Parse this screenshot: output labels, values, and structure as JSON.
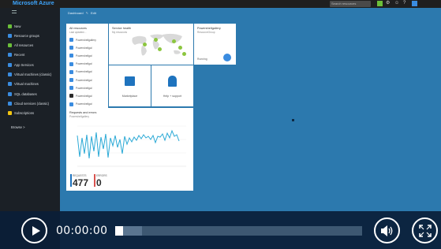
{
  "portal": {
    "brand": "Microsoft Azure",
    "search_placeholder": "Search resources"
  },
  "sidebar": {
    "items": [
      {
        "label": "New",
        "icon": "plus-icon",
        "color": "#6bbf3a"
      },
      {
        "label": "Resource groups",
        "icon": "cube-group-icon",
        "color": "#3a8ce0"
      },
      {
        "label": "All resources",
        "icon": "grid-icon",
        "color": "#6bbf3a"
      },
      {
        "label": "Recent",
        "icon": "clock-icon",
        "color": "#3a8ce0"
      },
      {
        "label": "App Services",
        "icon": "globe-icon",
        "color": "#3a8ce0"
      },
      {
        "label": "Virtual machines (classic)",
        "icon": "monitor-icon",
        "color": "#3a8ce0"
      },
      {
        "label": "Virtual machines",
        "icon": "monitor-icon",
        "color": "#3a8ce0"
      },
      {
        "label": "SQL databases",
        "icon": "database-icon",
        "color": "#3a8ce0"
      },
      {
        "label": "Cloud services (classic)",
        "icon": "cloud-icon",
        "color": "#3a8ce0"
      },
      {
        "label": "Subscriptions",
        "icon": "key-icon",
        "color": "#f2c511"
      }
    ],
    "browse": "Browse >"
  },
  "breadcrumb": {
    "title": "Dashboard",
    "edit_label": "Edit"
  },
  "tiles": {
    "all_resources": {
      "title": "All resources",
      "subtitle": "Last updated…",
      "rows": [
        "Powershellgallery",
        "Powershellgal",
        "Powershellgal",
        "Powershellgal",
        "Powershellgal",
        "Powershellgal",
        "Powershellgal",
        "Powershellgal",
        "Powershellgal"
      ]
    },
    "service_health": {
      "title": "Service health",
      "subtitle": "My resources"
    },
    "resource_group": {
      "title": "Powershellgallery",
      "subtitle": "ResourceGroup",
      "status": "Running"
    },
    "marketplace": {
      "label": "Marketplace"
    },
    "help_support": {
      "label": "Help + support"
    },
    "requests": {
      "title": "Requests and errors",
      "subtitle": "Powershellgallery",
      "counters": [
        {
          "label": "REQUESTS",
          "value": "477",
          "color": "#1e73be"
        },
        {
          "label": "ERRORS",
          "value": "0",
          "color": "#d9534f"
        }
      ]
    }
  },
  "player": {
    "time": "00:00:00",
    "progress": 0.0,
    "buffered": 0.11
  }
}
